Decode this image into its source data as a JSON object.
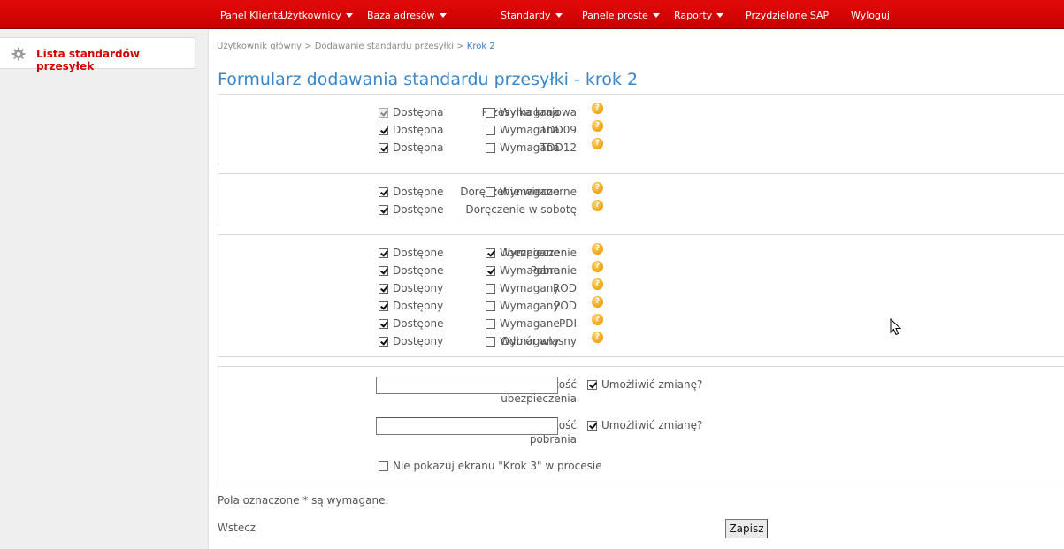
{
  "nav": {
    "items": [
      {
        "label": "Panel Klienta",
        "caret": false
      },
      {
        "label": "Użytkownicy",
        "caret": true
      },
      {
        "label": "Baza adresów",
        "caret": true
      },
      {
        "label": "Standardy",
        "caret": true
      },
      {
        "label": "Panele proste",
        "caret": true
      },
      {
        "label": "Raporty",
        "caret": true
      },
      {
        "label": "Przydzielone SAP",
        "caret": false
      },
      {
        "label": "Wyloguj",
        "caret": false
      }
    ]
  },
  "sidebar": {
    "items": [
      {
        "label": "Lista standardów przesyłek",
        "icon": "gear-icon"
      }
    ]
  },
  "breadcrumb": {
    "path": "Użytkownik główny > Dodawanie standardu przesyłki > ",
    "current": "Krok 2"
  },
  "page_title": "Formularz dodawania standardu przesyłki - krok 2",
  "section1": {
    "rows": [
      {
        "label": "Przesyłka krajowa",
        "available": {
          "label": "Dostępna",
          "checked": true,
          "disabled": true
        },
        "required": {
          "label": "Wymagana",
          "checked": false
        }
      },
      {
        "label": "TDD09",
        "available": {
          "label": "Dostępna",
          "checked": true
        },
        "required": {
          "label": "Wymagana",
          "checked": false
        }
      },
      {
        "label": "TDD12",
        "available": {
          "label": "Dostępna",
          "checked": true
        },
        "required": {
          "label": "Wymagana",
          "checked": false
        }
      }
    ]
  },
  "section2": {
    "rows": [
      {
        "label": "Doręczenie wieczorne",
        "available": {
          "label": "Dostępne",
          "checked": true
        },
        "required": {
          "label": "Wymagane",
          "checked": false
        }
      },
      {
        "label": "Doręczenie w sobotę",
        "available": {
          "label": "Dostępne",
          "checked": true
        }
      }
    ]
  },
  "section3": {
    "rows": [
      {
        "label": "Ubezpieczenie",
        "available": {
          "label": "Dostępne",
          "checked": true
        },
        "required": {
          "label": "Wymagane",
          "checked": true
        }
      },
      {
        "label": "Pobranie",
        "available": {
          "label": "Dostępne",
          "checked": true
        },
        "required": {
          "label": "Wymagane",
          "checked": true
        }
      },
      {
        "label": "ROD",
        "available": {
          "label": "Dostępny",
          "checked": true
        },
        "required": {
          "label": "Wymagany",
          "checked": false
        }
      },
      {
        "label": "POD",
        "available": {
          "label": "Dostępny",
          "checked": true
        },
        "required": {
          "label": "Wymagany",
          "checked": false
        }
      },
      {
        "label": "PDI",
        "available": {
          "label": "Dostępne",
          "checked": true
        },
        "required": {
          "label": "Wymagane",
          "checked": false
        }
      },
      {
        "label": "Odbiór własny",
        "available": {
          "label": "Dostępny",
          "checked": true
        },
        "required": {
          "label": "Wymagany",
          "checked": false
        }
      }
    ]
  },
  "section4": {
    "insurance": {
      "label_line1": "Domyślna wartość",
      "label_line2": "ubezpieczenia",
      "value": "",
      "allow_change": {
        "label": "Umożliwić zmianę?",
        "checked": true
      }
    },
    "cod": {
      "label_line1": "Domyślna wartość",
      "label_line2": "pobrania",
      "value": "",
      "allow_change": {
        "label": "Umożliwić zmianę?",
        "checked": true
      }
    },
    "skip_step3": {
      "label": "Nie pokazuj ekranu \"Krok 3\" w procesie",
      "checked": false
    }
  },
  "footnote": "Pola oznaczone * są wymagane.",
  "back_label": "Wstecz",
  "save_label": "Zapisz",
  "help_glyph": "?",
  "colors": {
    "nav_red": "#d40000",
    "title_blue": "#3a86c8",
    "help_orange": "#f0a010"
  }
}
